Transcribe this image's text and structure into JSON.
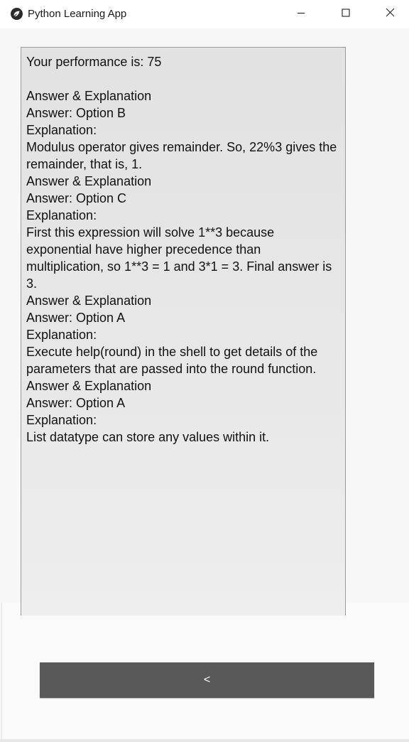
{
  "window": {
    "title": "Python Learning App",
    "icon": "kivy-logo-icon"
  },
  "controls": {
    "minimize_icon": "minimize-icon",
    "maximize_icon": "maximize-icon",
    "close_icon": "close-icon"
  },
  "results": {
    "performance": "Your performance is: 75",
    "items": [
      {
        "heading": "Answer & Explanation",
        "answer": "Answer: Option B",
        "explanation_label": "Explanation:",
        "explanation": "Modulus operator gives remainder. So, 22%3 gives the remainder, that is, 1."
      },
      {
        "heading": "Answer & Explanation",
        "answer": "Answer: Option C",
        "explanation_label": "Explanation:",
        "explanation": "First this expression will solve 1**3 because exponential have higher precedence than multiplication, so 1**3 = 1 and 3*1 = 3. Final answer is 3."
      },
      {
        "heading": "Answer & Explanation",
        "answer": "Answer: Option A",
        "explanation_label": "Explanation:",
        "explanation": "Execute help(round) in the shell to get details of the parameters that are passed into the round function."
      },
      {
        "heading": "Answer & Explanation",
        "answer": "Answer: Option A",
        "explanation_label": "Explanation:",
        "explanation": "List datatype can store any values within it."
      }
    ]
  },
  "buttons": {
    "back_label": "<"
  },
  "colors": {
    "button_bg": "#595959",
    "textarea_bg": "#e6e6e6",
    "text": "#111111"
  }
}
